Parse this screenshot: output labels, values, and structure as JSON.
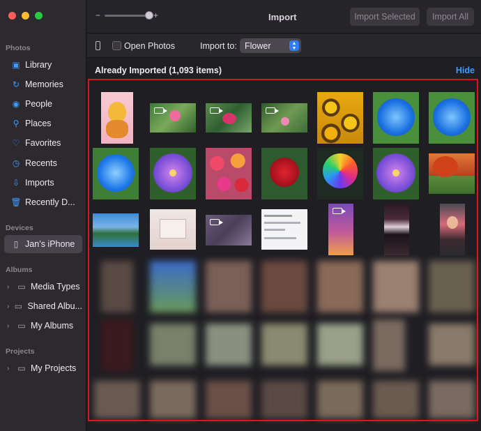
{
  "window": {
    "title": "Import"
  },
  "toolbar": {
    "zoom_minus": "−",
    "zoom_plus": "+",
    "zoom_level": 0.9,
    "import_selected_label": "Import Selected",
    "import_all_label": "Import All"
  },
  "sidebar": {
    "sections": {
      "photos": "Photos",
      "devices": "Devices",
      "albums": "Albums",
      "projects": "Projects"
    },
    "items": [
      {
        "label": "Library",
        "icon": "library-icon"
      },
      {
        "label": "Memories",
        "icon": "memories-icon"
      },
      {
        "label": "People",
        "icon": "people-icon"
      },
      {
        "label": "Places",
        "icon": "places-icon"
      },
      {
        "label": "Favorites",
        "icon": "heart-icon"
      },
      {
        "label": "Recents",
        "icon": "clock-icon"
      },
      {
        "label": "Imports",
        "icon": "imports-icon"
      },
      {
        "label": "Recently D...",
        "icon": "trash-icon"
      }
    ],
    "device": {
      "label": "Jan’s iPhone",
      "icon": "iphone-icon"
    },
    "albums": [
      {
        "label": "Media Types",
        "icon": "folder-icon"
      },
      {
        "label": "Shared Albu...",
        "icon": "folder-icon"
      },
      {
        "label": "My Albums",
        "icon": "folder-icon"
      }
    ],
    "projects": [
      {
        "label": "My Projects",
        "icon": "folder-icon"
      }
    ]
  },
  "subbar": {
    "open_photos_label": "Open Photos",
    "open_photos_checked": false,
    "import_to_label": "Import to:",
    "import_to_value": "Flower"
  },
  "main": {
    "header": "Already Imported (1,093 items)",
    "hide_label": "Hide"
  },
  "colors": {
    "accent": "#3f9bff",
    "highlight_border": "#e0141b",
    "sidebar_bg": "#2d2a2f",
    "main_bg": "#1f1e23"
  }
}
